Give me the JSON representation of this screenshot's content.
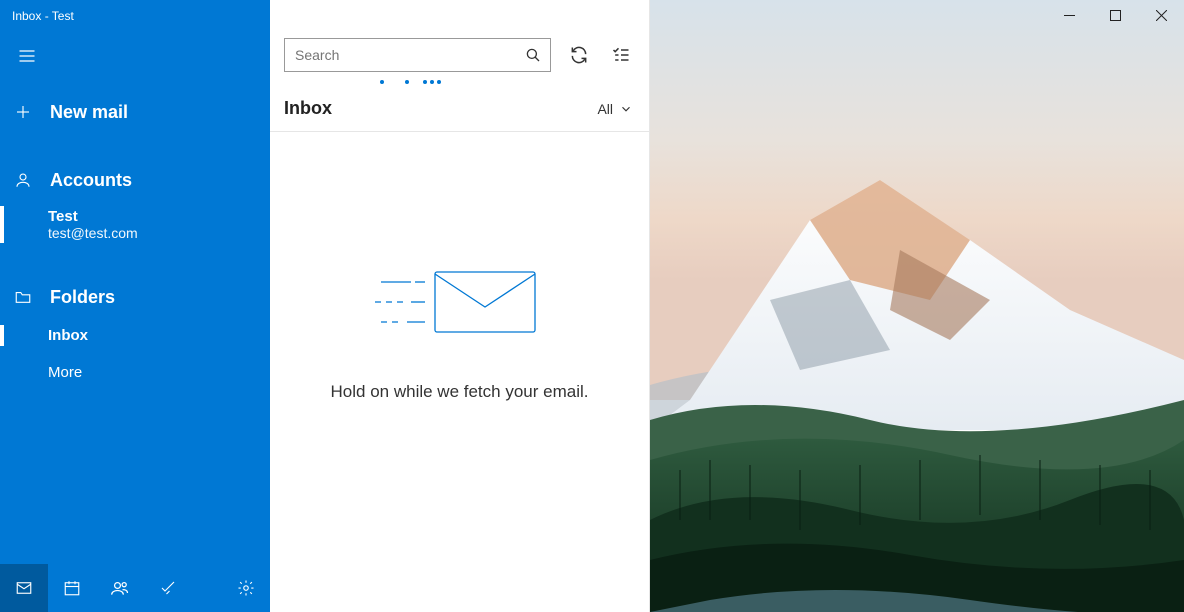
{
  "window": {
    "title": "Inbox - Test"
  },
  "sidebar": {
    "new_mail_label": "New mail",
    "accounts_label": "Accounts",
    "account": {
      "name": "Test",
      "email": "test@test.com"
    },
    "folders_label": "Folders",
    "folders": {
      "inbox": "Inbox",
      "more": "More"
    }
  },
  "list": {
    "search_placeholder": "Search",
    "header_title": "Inbox",
    "filter_label": "All",
    "empty_message": "Hold on while we fetch your email."
  }
}
